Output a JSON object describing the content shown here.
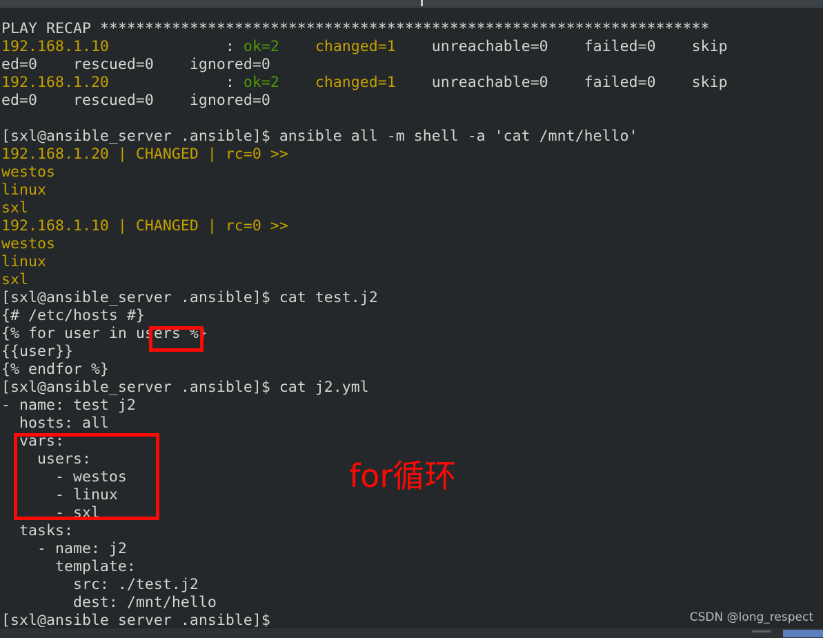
{
  "window": {
    "title": "",
    "theme": {
      "background": "#24282b",
      "foreground": "#d3d7cf",
      "yellow": "#c4a000",
      "green": "#4e9a06",
      "annotation_red": "#fb0b05",
      "titlebar": "#3b4144",
      "statusbar": "#2d3134",
      "scrollbar_thumb": "#5b7fc0"
    }
  },
  "annotations": {
    "callout_label": "for循环",
    "boxes": [
      {
        "name": "users-variable-highlight",
        "target": "users"
      },
      {
        "name": "vars-block-highlight",
        "target": "vars: users: - westos - linux - sxl"
      }
    ]
  },
  "watermark": {
    "text": "CSDN @long_respect"
  },
  "prompt": {
    "user": "sxl",
    "host": "ansible_server",
    "cwd": ".ansible",
    "string": "[sxl@ansible_server .ansible]$ "
  },
  "terminal": {
    "lines": [
      {
        "id": "l01",
        "segments": [
          {
            "c": "w",
            "t": "PLAY RECAP ********************************************************************"
          }
        ]
      },
      {
        "id": "l02",
        "segments": [
          {
            "c": "y",
            "t": "192.168.1.10"
          },
          {
            "c": "w",
            "t": "             : "
          },
          {
            "c": "g",
            "t": "ok=2"
          },
          {
            "c": "w",
            "t": "    "
          },
          {
            "c": "y",
            "t": "changed=1"
          },
          {
            "c": "w",
            "t": "    unreachable=0    failed=0    skip"
          }
        ]
      },
      {
        "id": "l03",
        "segments": [
          {
            "c": "w",
            "t": "ed=0    rescued=0    ignored=0"
          }
        ]
      },
      {
        "id": "l04",
        "segments": [
          {
            "c": "y",
            "t": "192.168.1.20"
          },
          {
            "c": "w",
            "t": "             : "
          },
          {
            "c": "g",
            "t": "ok=2"
          },
          {
            "c": "w",
            "t": "    "
          },
          {
            "c": "y",
            "t": "changed=1"
          },
          {
            "c": "w",
            "t": "    unreachable=0    failed=0    skip"
          }
        ]
      },
      {
        "id": "l05",
        "segments": [
          {
            "c": "w",
            "t": "ed=0    rescued=0    ignored=0"
          }
        ]
      },
      {
        "id": "l06",
        "segments": [
          {
            "c": "w",
            "t": ""
          }
        ]
      },
      {
        "id": "l07",
        "segments": [
          {
            "c": "w",
            "t": "[sxl@ansible_server .ansible]$ ansible all -m shell -a 'cat /mnt/hello'"
          }
        ]
      },
      {
        "id": "l08",
        "segments": [
          {
            "c": "y",
            "t": "192.168.1.20 | CHANGED | rc=0 >>"
          }
        ]
      },
      {
        "id": "l09",
        "segments": [
          {
            "c": "y",
            "t": "westos"
          }
        ]
      },
      {
        "id": "l10",
        "segments": [
          {
            "c": "y",
            "t": "linux"
          }
        ]
      },
      {
        "id": "l11",
        "segments": [
          {
            "c": "y",
            "t": "sxl"
          }
        ]
      },
      {
        "id": "l12",
        "segments": [
          {
            "c": "y",
            "t": "192.168.1.10 | CHANGED | rc=0 >>"
          }
        ]
      },
      {
        "id": "l13",
        "segments": [
          {
            "c": "y",
            "t": "westos"
          }
        ]
      },
      {
        "id": "l14",
        "segments": [
          {
            "c": "y",
            "t": "linux"
          }
        ]
      },
      {
        "id": "l15",
        "segments": [
          {
            "c": "y",
            "t": "sxl"
          }
        ]
      },
      {
        "id": "l16",
        "segments": [
          {
            "c": "w",
            "t": "[sxl@ansible_server .ansible]$ cat test.j2"
          }
        ]
      },
      {
        "id": "l17",
        "segments": [
          {
            "c": "w",
            "t": "{# /etc/hosts #}"
          }
        ]
      },
      {
        "id": "l18",
        "segments": [
          {
            "c": "w",
            "t": "{% for user in users %}"
          }
        ]
      },
      {
        "id": "l19",
        "segments": [
          {
            "c": "w",
            "t": "{{user}}"
          }
        ]
      },
      {
        "id": "l20",
        "segments": [
          {
            "c": "w",
            "t": "{% endfor %}"
          }
        ]
      },
      {
        "id": "l21",
        "segments": [
          {
            "c": "w",
            "t": "[sxl@ansible_server .ansible]$ cat j2.yml"
          }
        ]
      },
      {
        "id": "l22",
        "segments": [
          {
            "c": "w",
            "t": "- name: test j2"
          }
        ]
      },
      {
        "id": "l23",
        "segments": [
          {
            "c": "w",
            "t": "  hosts: all"
          }
        ]
      },
      {
        "id": "l24",
        "segments": [
          {
            "c": "w",
            "t": "  vars:"
          }
        ]
      },
      {
        "id": "l25",
        "segments": [
          {
            "c": "w",
            "t": "    users:"
          }
        ]
      },
      {
        "id": "l26",
        "segments": [
          {
            "c": "w",
            "t": "      - westos"
          }
        ]
      },
      {
        "id": "l27",
        "segments": [
          {
            "c": "w",
            "t": "      - linux"
          }
        ]
      },
      {
        "id": "l28",
        "segments": [
          {
            "c": "w",
            "t": "      - sxl"
          }
        ]
      },
      {
        "id": "l29",
        "segments": [
          {
            "c": "w",
            "t": "  tasks:"
          }
        ]
      },
      {
        "id": "l30",
        "segments": [
          {
            "c": "w",
            "t": "    - name: j2"
          }
        ]
      },
      {
        "id": "l31",
        "segments": [
          {
            "c": "w",
            "t": "      template:"
          }
        ]
      },
      {
        "id": "l32",
        "segments": [
          {
            "c": "w",
            "t": "        src: ./test.j2"
          }
        ]
      },
      {
        "id": "l33",
        "segments": [
          {
            "c": "w",
            "t": "        dest: /mnt/hello"
          }
        ]
      },
      {
        "id": "l34",
        "segments": [
          {
            "c": "w",
            "t": "[sxl@ansible_server .ansible]$"
          }
        ]
      }
    ]
  }
}
